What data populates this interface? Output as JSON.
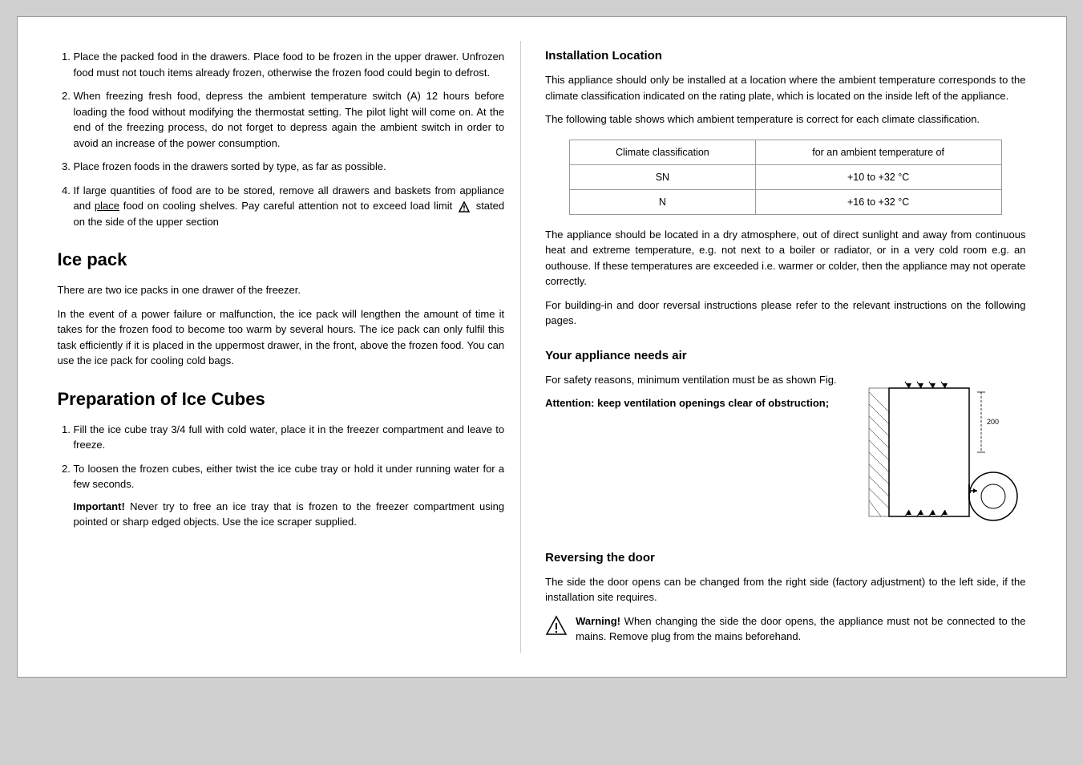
{
  "left": {
    "list1": [
      {
        "id": 1,
        "text": "Place the packed food in the drawers. Place food to be frozen in the upper drawer. Unfrozen food must not touch items already frozen, otherwise the frozen food could begin to defrost."
      },
      {
        "id": 2,
        "text": "When freezing fresh food, depress the ambient temperature switch (A) 12 hours before loading the food without modifying the thermostat setting. The pilot light will come on. At the end of the freezing process, do not forget to depress again the ambient switch in order to avoid an increase of the power consumption."
      },
      {
        "id": 3,
        "text": "Place frozen foods in the drawers sorted by type, as far as possible."
      },
      {
        "id": 4,
        "text": "If large quantities of food are to be stored, remove all drawers and baskets from appliance and place food on cooling shelves. Pay careful attention not to exceed load limit"
      }
    ],
    "list1_item4_suffix": "stated on the side of the upper section",
    "section2_title": "Ice  pack",
    "section2_para1": "There are two ice packs in one drawer of the freezer.",
    "section2_para2": "In the event of a power failure or malfunction, the ice pack will lengthen the amount of time it takes for the frozen food to become too warm by several hours. The ice pack can only fulfil this task efficiently if it is placed in the uppermost drawer, in the front, above the frozen food. You can use the ice pack for cooling cold bags.",
    "section3_title": "Preparation of  Ice  Cubes",
    "list2": [
      {
        "id": 1,
        "text": "Fill the ice cube tray 3/4 full with cold water, place it in the freezer compartment and leave to freeze."
      },
      {
        "id": 2,
        "text": "To loosen the frozen cubes, either twist the ice cube tray or hold it under running water for a few seconds."
      }
    ],
    "important_label": "Important!",
    "important_text": "Never try to free an ice tray that is frozen to the freezer compartment using pointed or sharp edged objects. Use the ice scraper supplied."
  },
  "right": {
    "section1_title": "Installation Location",
    "section1_para1": "This appliance should only be installed at a location where the ambient temperature corresponds to the climate classification indicated on the rating plate, which is located on the inside left of the appliance.",
    "section1_para2": "The following table shows which ambient temperature is correct for each climate classification.",
    "table": {
      "col1_header": "Climate classification",
      "col2_header": "for an ambient temperature of",
      "rows": [
        {
          "col1": "SN",
          "col2": "+10 to +32 °C"
        },
        {
          "col1": "N",
          "col2": "+16 to +32 °C"
        }
      ]
    },
    "section1_para3": "The appliance should be located in a dry atmosphere, out of direct sunlight and away from continuous heat and extreme temperature, e.g. not next to a boiler or radiator, or in a very cold room e.g. an outhouse. If these temperatures are exceeded i.e. warmer or colder, then the appliance may not operate correctly.",
    "section1_para4": "For building-in and door reversal instructions please refer to the relevant instructions on the following pages.",
    "section2_title": "Your  appliance  needs  air",
    "section2_para1": "For safety reasons, minimum ventilation must be as shown Fig.",
    "section2_attention": "Attention: keep ventilation openings clear of obstruction;",
    "section3_title": "Reversing the door",
    "section3_para1": "The side  the door opens can be changed from the right side (factory adjustment) to the left side, if the installation site requires.",
    "warning_label": "Warning!",
    "warning_text": "When changing the side the door opens, the appliance must not be connected to the mains. Remove plug from the mains beforehand."
  }
}
